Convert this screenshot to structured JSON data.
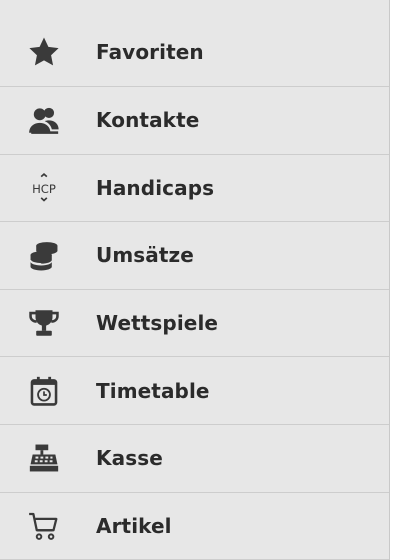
{
  "menu": {
    "accent_color": "#5fae3a",
    "items": [
      {
        "label": "Favoriten",
        "icon": "star-icon"
      },
      {
        "label": "Kontakte",
        "icon": "contacts-icon"
      },
      {
        "label": "Handicaps",
        "icon": "hcp-icon"
      },
      {
        "label": "Umsätze",
        "icon": "coins-icon"
      },
      {
        "label": "Wettspiele",
        "icon": "trophy-icon"
      },
      {
        "label": "Timetable",
        "icon": "calendar-clock-icon"
      },
      {
        "label": "Kasse",
        "icon": "cash-register-icon"
      },
      {
        "label": "Artikel",
        "icon": "cart-icon"
      }
    ]
  }
}
